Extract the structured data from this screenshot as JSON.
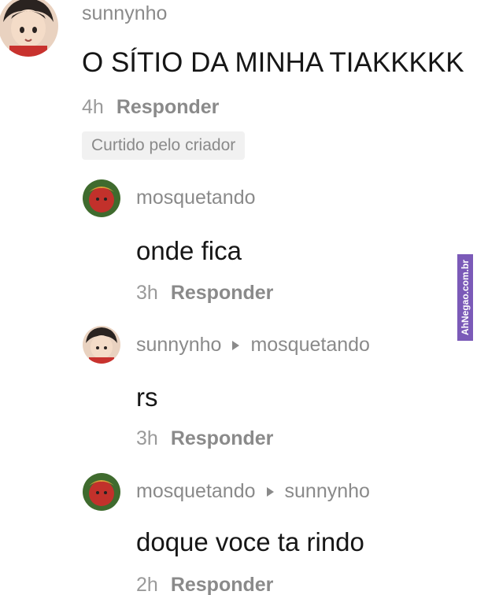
{
  "main_comment": {
    "username": "sunnynho",
    "text": "O SÍTIO DA MINHA TIAKKKKK",
    "time": "4h",
    "reply_label": "Responder",
    "badge": "Curtido pelo criador"
  },
  "replies": [
    {
      "username": "mosquetando",
      "text": "onde fica",
      "time": "3h",
      "reply_label": "Responder"
    },
    {
      "username": "sunnynho",
      "reply_to": "mosquetando",
      "text": "rs",
      "time": "3h",
      "reply_label": "Responder"
    },
    {
      "username": "mosquetando",
      "reply_to": "sunnynho",
      "text": "doque voce ta rindo",
      "time": "2h",
      "reply_label": "Responder"
    }
  ],
  "watermark": "AhNegao.com.br",
  "icons": [
    "anime-boy-avatar",
    "anime-boy-avatar-small",
    "red-character-avatar",
    "reply-arrow-icon"
  ],
  "colors": {
    "muted": "#8a8a8a",
    "text": "#161616",
    "badge_bg": "#f1f1f1",
    "watermark_bg": "#7b5ab8"
  }
}
